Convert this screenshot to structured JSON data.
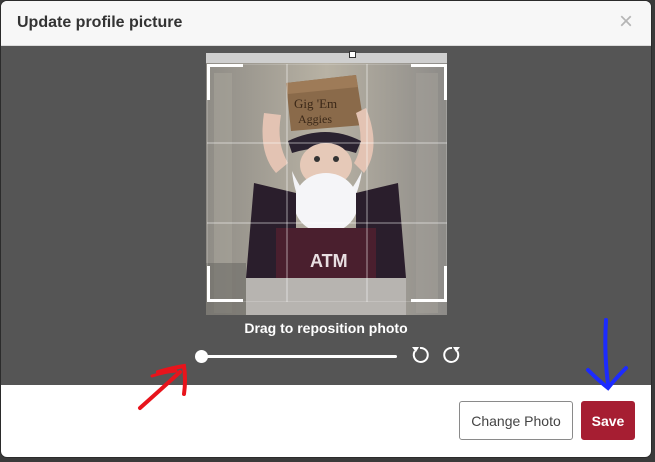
{
  "dialog": {
    "title": "Update profile picture",
    "close_symbol": "×"
  },
  "editor": {
    "photo_caption": "Drag to reposition photo",
    "zoom_level": 0,
    "rotate_left_icon": "rotate-left-icon",
    "rotate_right_icon": "rotate-right-icon"
  },
  "footer": {
    "change_photo_label": "Change Photo",
    "save_label": "Save"
  },
  "colors": {
    "editor_bg": "#555555",
    "save_button": "#a61e32",
    "annotation_red": "#e8141c",
    "annotation_blue": "#1c2bff"
  }
}
